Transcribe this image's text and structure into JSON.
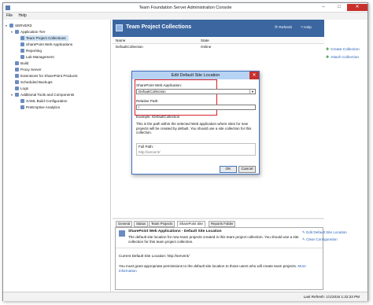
{
  "window": {
    "title": "Team Foundation Server Administration Console",
    "minimize": "–",
    "maximize": "□",
    "close": "✕"
  },
  "menu": {
    "file": "File",
    "help": "Help"
  },
  "tree": {
    "root": "SERVER3",
    "items": [
      "Application Tier",
      "Team Project Collections",
      "SharePoint Web Applications",
      "Reporting",
      "Lab Management",
      "Build",
      "Proxy Server",
      "Extensions for SharePoint Products",
      "Scheduled Backups",
      "Logs",
      "Additional Tools and Components",
      "XAML Build Configuration",
      "PreEmptive Analytics"
    ]
  },
  "header": {
    "title": "Team Project Collections",
    "refresh": "Refresh",
    "help": "Help"
  },
  "actions": {
    "create": "Create Collection",
    "attach": "Attach Collection"
  },
  "grid": {
    "col_name": "Name",
    "col_state": "State",
    "row_name": "DefaultCollection",
    "row_state": "Online"
  },
  "tabs": [
    "General",
    "Status",
    "Team Projects",
    "SharePoint Site",
    "Reports Folder"
  ],
  "detail": {
    "title": "SharePoint Web Applications - Default Site Location",
    "desc": "The default site location for new team projects created in this team project collection. You should use a site collection for this team project collection.",
    "current": "Current Default Site Location:  http://server3/",
    "permission": "You must grant appropriate permissions to the default site location to those users who will create team projects.",
    "more_info": "More information",
    "edit_link": "Edit Default Site Location",
    "clear_link": "Clear Configuration"
  },
  "dialog": {
    "title": "Edit Default Site Location",
    "close": "✕",
    "webapp_label": "SharePoint Web Application:",
    "webapp_value": "DefaultCollection",
    "relpath_label": "Relative Path:",
    "relpath_value": "/",
    "example": "Example: /DefaultCollection",
    "explain": "This is the path within the selected Web application where sites for new projects will be created by default. You should use a site collection for this collection.",
    "fullpath_label": "Full Path:",
    "fullpath_value": "http://server3/",
    "ok": "OK",
    "cancel": "Cancel"
  },
  "status": {
    "last_refresh": "Last Refresh: 1/1/2016 1:22:23 PM"
  }
}
